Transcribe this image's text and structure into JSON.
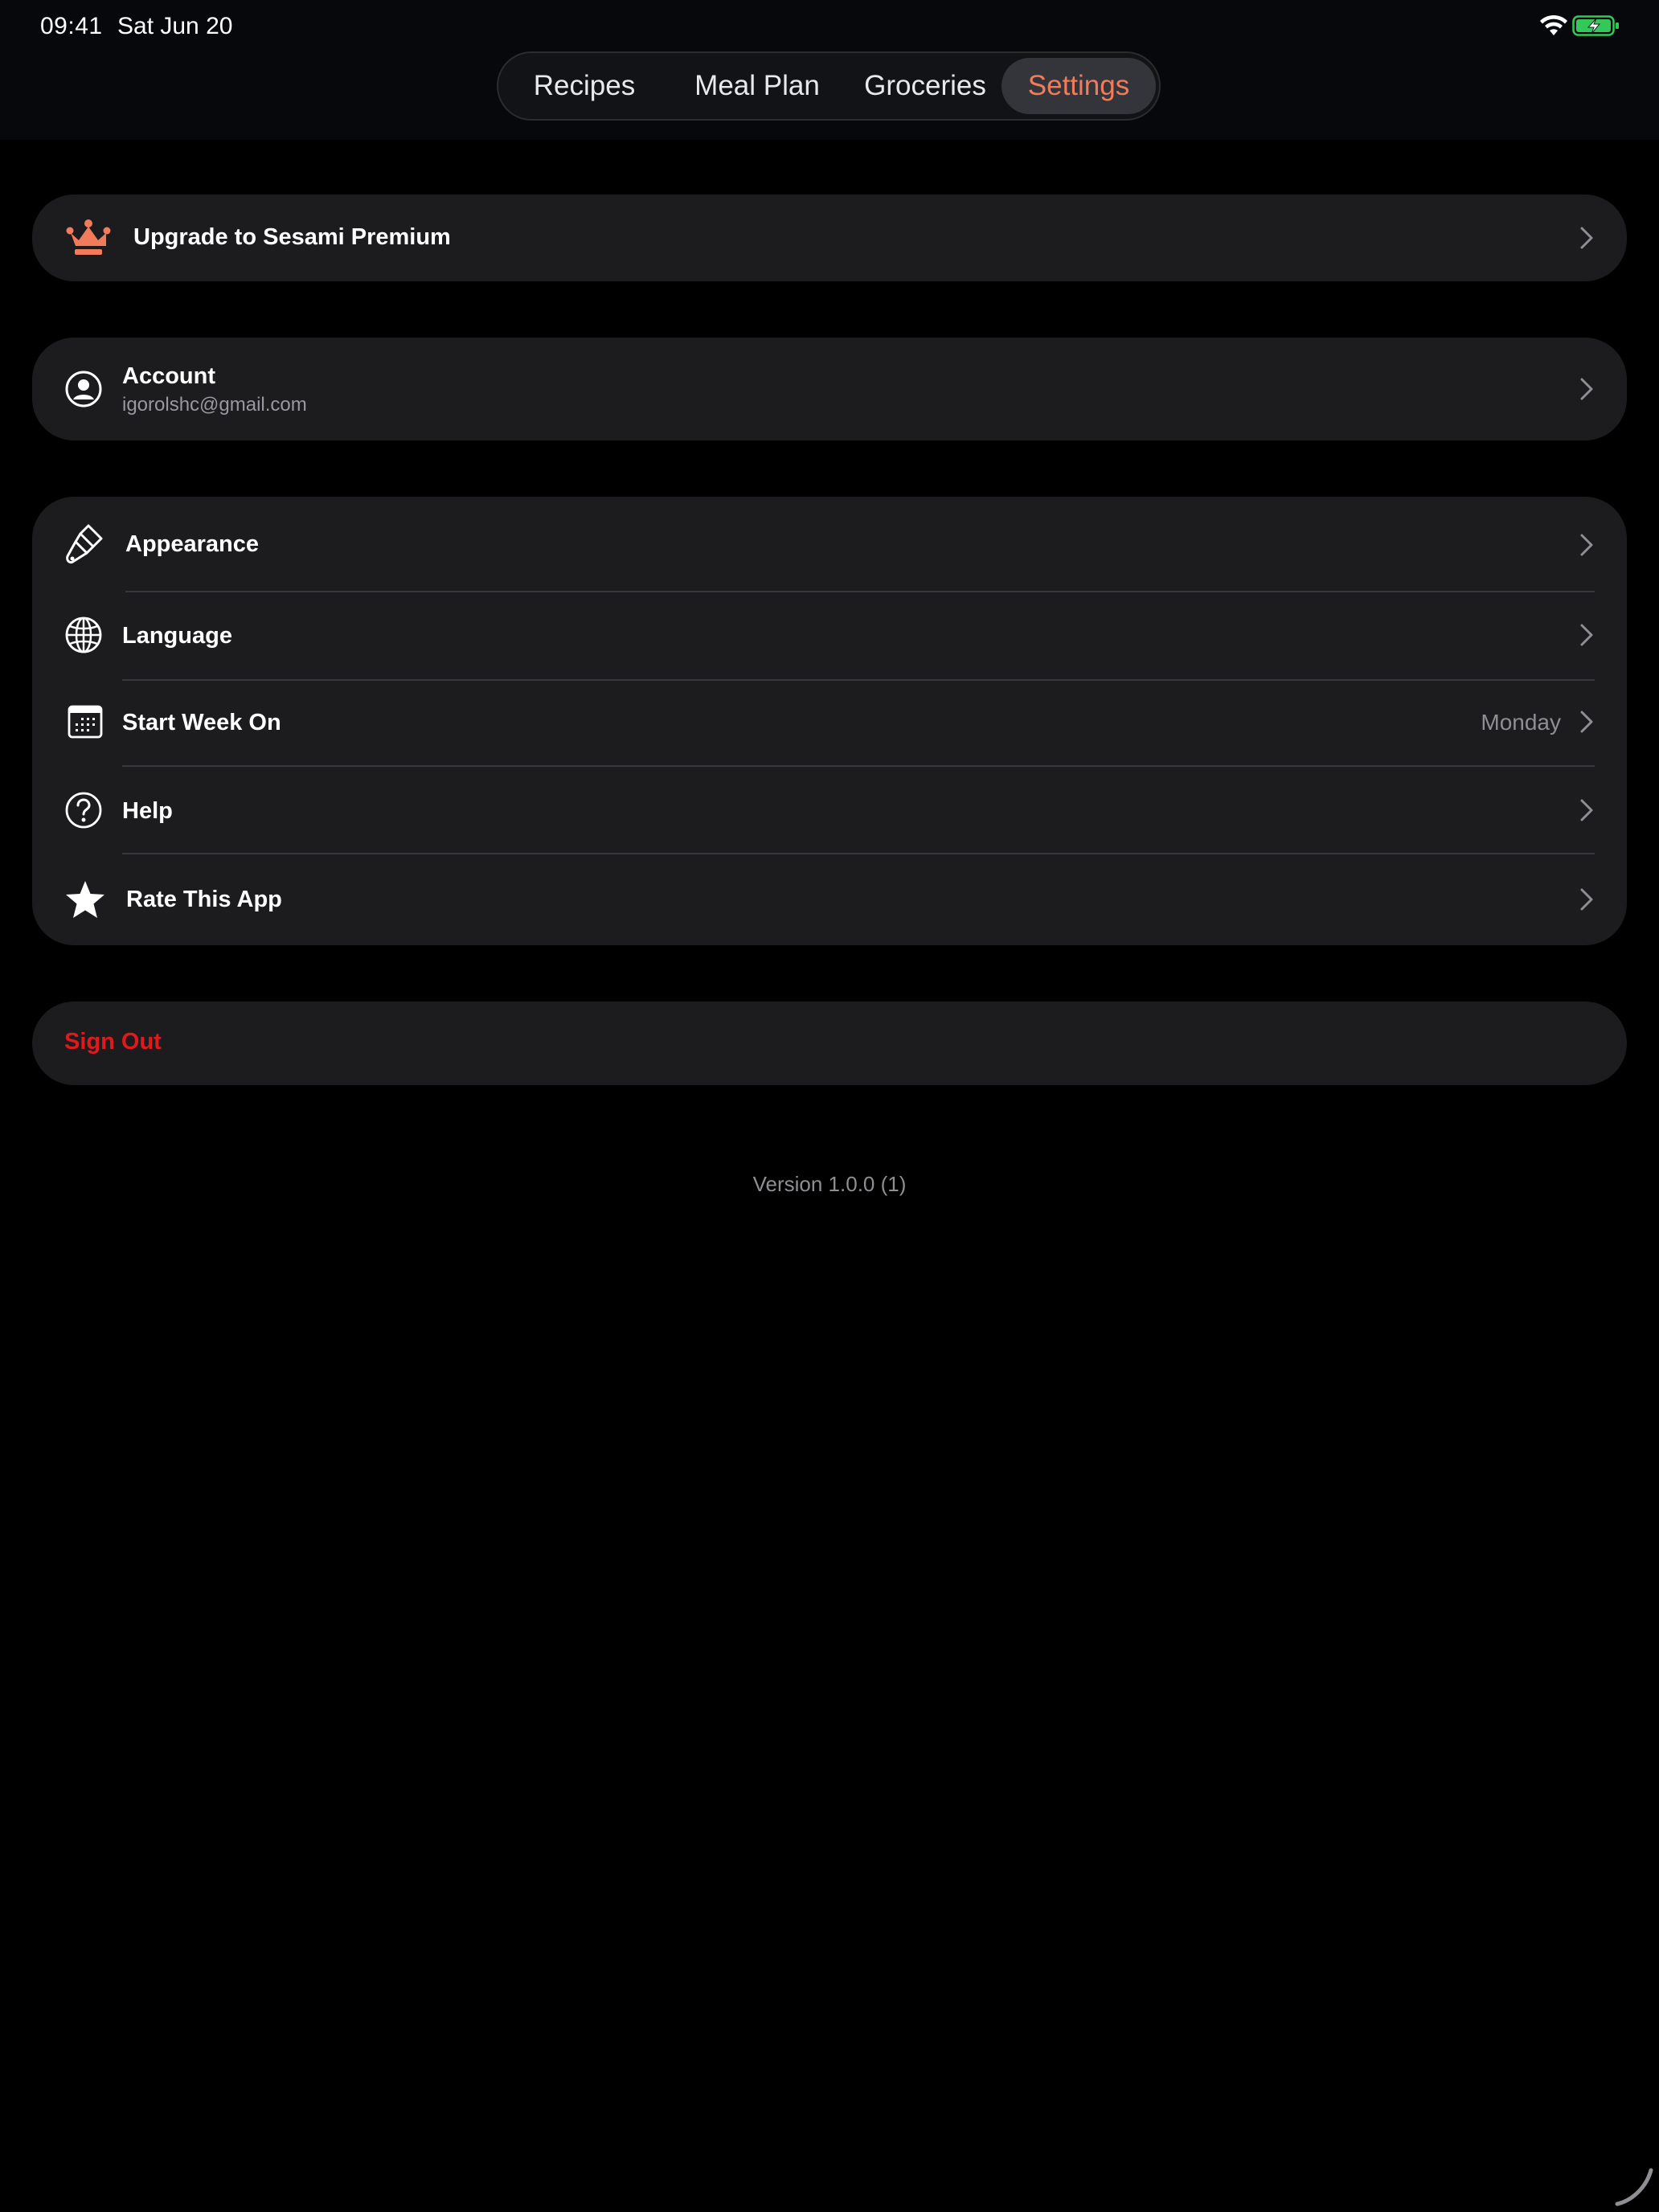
{
  "status_bar": {
    "time": "09:41",
    "date": "Sat Jun 20",
    "wifi_icon": "wifi-icon",
    "battery_icon": "battery-charging-icon",
    "battery_color": "#34c759"
  },
  "nav": {
    "tabs": [
      {
        "label": "Recipes",
        "active": false
      },
      {
        "label": "Meal Plan",
        "active": false
      },
      {
        "label": "Groceries",
        "active": false
      },
      {
        "label": "Settings",
        "active": true
      }
    ],
    "accent_color": "#f27b5b"
  },
  "premium": {
    "label": "Upgrade to Sesami Premium",
    "icon": "crown-icon",
    "icon_color": "#f27b5b"
  },
  "account": {
    "label": "Account",
    "email": "igorolshc@gmail.com",
    "icon": "person-circle-icon"
  },
  "settings": {
    "items": [
      {
        "label": "Appearance",
        "icon": "paintbrush-icon",
        "value": ""
      },
      {
        "label": "Language",
        "icon": "globe-icon",
        "value": ""
      },
      {
        "label": "Start Week On",
        "icon": "calendar-icon",
        "value": "Monday"
      },
      {
        "label": "Help",
        "icon": "question-circle-icon",
        "value": ""
      },
      {
        "label": "Rate This App",
        "icon": "star-icon",
        "value": ""
      }
    ]
  },
  "sign_out": {
    "label": "Sign Out",
    "color": "#e0191c"
  },
  "footer": {
    "version": "Version 1.0.0 (1)"
  }
}
